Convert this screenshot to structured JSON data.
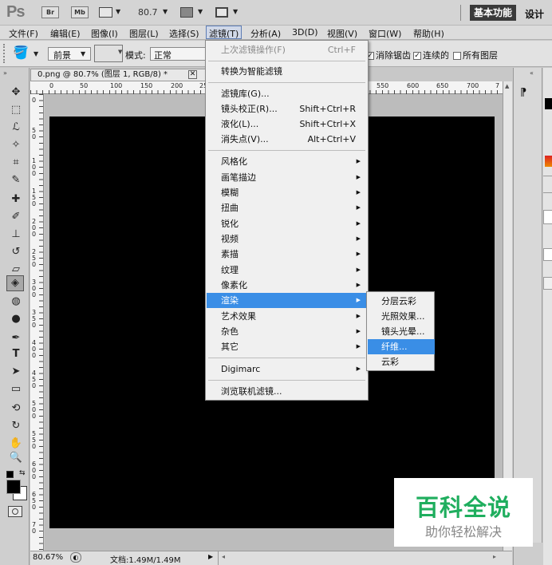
{
  "app": {
    "logo": "Ps",
    "bridge_btn": "Br",
    "minibridge_btn": "Mb",
    "zoom": "80.7",
    "workspace_essentials": "基本功能",
    "workspace_design": "设计"
  },
  "menubar": {
    "items": [
      "文件(F)",
      "编辑(E)",
      "图像(I)",
      "图层(L)",
      "选择(S)",
      "滤镜(T)",
      "分析(A)",
      "3D(D)",
      "视图(V)",
      "窗口(W)",
      "帮助(H)"
    ]
  },
  "options": {
    "fg_label": "前景",
    "mode_label": "模式:",
    "mode_value": "正常",
    "antialias": "消除锯齿",
    "contiguous": "连续的",
    "all_layers": "所有图层"
  },
  "document": {
    "tab_title": "0.png @ 80.7% (图层 1, RGB/8) *",
    "ruler_top": [
      "0",
      "50",
      "100",
      "150",
      "200",
      "25",
      "550",
      "600",
      "650",
      "700",
      "7"
    ],
    "ruler_left": [
      "0",
      "5 0",
      "1 0 0",
      "1 5 0",
      "2 0 0",
      "2 5 0",
      "3 0 0",
      "3 5 0",
      "4 0 0",
      "4 5 0",
      "5 0 0",
      "5 5 0",
      "6 0 0",
      "6 5 0",
      "7 0"
    ],
    "status_zoom": "80.67%",
    "status_doc": "文档:1.49M/1.49M"
  },
  "filter_menu": {
    "last_filter": "上次滤镜操作(F)",
    "last_filter_sc": "Ctrl+F",
    "smart": "转换为智能滤镜",
    "gallery": "滤镜库(G)...",
    "lens": "镜头校正(R)...",
    "lens_sc": "Shift+Ctrl+R",
    "liquify": "液化(L)...",
    "liquify_sc": "Shift+Ctrl+X",
    "vanish": "消失点(V)...",
    "vanish_sc": "Alt+Ctrl+V",
    "groups": [
      "风格化",
      "画笔描边",
      "模糊",
      "扭曲",
      "锐化",
      "视频",
      "素描",
      "纹理",
      "像素化",
      "渲染",
      "艺术效果",
      "杂色",
      "其它"
    ],
    "digimarc": "Digimarc",
    "browse": "浏览联机滤镜..."
  },
  "render_submenu": {
    "items": [
      "分层云彩",
      "光照效果...",
      "镜头光晕...",
      "纤维...",
      "云彩"
    ]
  },
  "watermark": {
    "title": "百科全说",
    "subtitle": "助你轻松解决"
  },
  "colors": {
    "highlight": "#3a8ee6",
    "watermark_green": "#1fae5e",
    "canvas": "#000000"
  }
}
